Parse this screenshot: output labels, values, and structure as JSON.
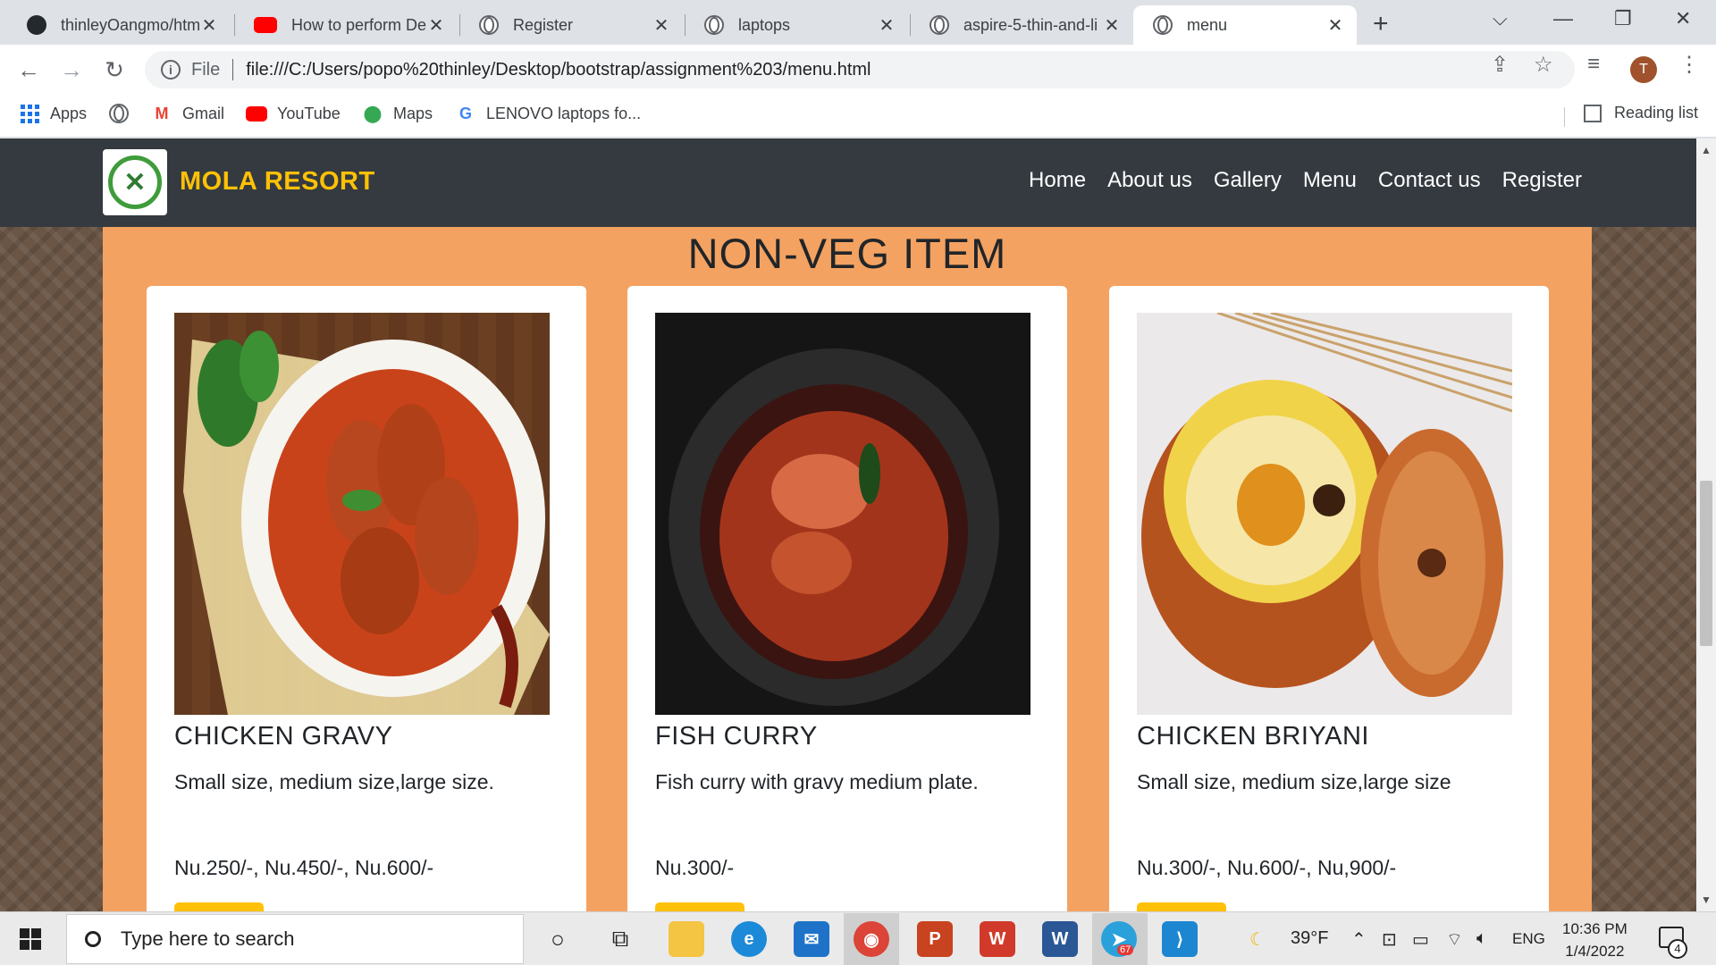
{
  "browser": {
    "tabs": [
      {
        "title": "thinleyOangmo/htm",
        "favicon": "github-icon"
      },
      {
        "title": "How to perform De",
        "favicon": "youtube-icon"
      },
      {
        "title": "Register",
        "favicon": "globe-icon"
      },
      {
        "title": "laptops",
        "favicon": "globe-icon"
      },
      {
        "title": "aspire-5-thin-and-li",
        "favicon": "globe-icon"
      },
      {
        "title": "menu",
        "favicon": "globe-icon",
        "active": true
      }
    ],
    "address": {
      "scheme_label": "File",
      "url": "file:///C:/Users/popo%20thinley/Desktop/bootstrap/assignment%203/menu.html"
    },
    "profile_initial": "T",
    "bookmarks": [
      {
        "label": "Apps",
        "icon": "apps-grid-icon"
      },
      {
        "label": "",
        "icon": "globe-icon"
      },
      {
        "label": "Gmail",
        "icon": "gmail-icon"
      },
      {
        "label": "YouTube",
        "icon": "youtube-icon"
      },
      {
        "label": "Maps",
        "icon": "maps-pin-icon"
      },
      {
        "label": "LENOVO laptops fo...",
        "icon": "google-icon"
      }
    ],
    "reading_list_label": "Reading list"
  },
  "site": {
    "brand": "MOLA RESORT",
    "nav": [
      "Home",
      "About us",
      "Gallery",
      "Menu",
      "Contact us",
      "Register"
    ],
    "section_title": "NON-VEG ITEM",
    "items": [
      {
        "title": "CHICKEN GRAVY",
        "description": "Small size, medium size,large size.",
        "price": "Nu.250/-, Nu.450/-, Nu.600/-"
      },
      {
        "title": "FISH CURRY",
        "description": "Fish curry with gravy medium plate.",
        "price": "Nu.300/-"
      },
      {
        "title": "CHICKEN BRIYANI",
        "description": "Small size, medium size,large size",
        "price": "Nu.300/-, Nu.600/-, Nu,900/-"
      }
    ],
    "colors": {
      "navbar": "#343a40",
      "brand": "#ffc107",
      "panel": "#f4a261",
      "button": "#ffc107"
    }
  },
  "taskbar": {
    "search_placeholder": "Type here to search",
    "weather": "39°F",
    "language": "ENG",
    "time": "10:36 PM",
    "date": "1/4/2022",
    "notification_count": "4",
    "telegram_badge": "67"
  }
}
